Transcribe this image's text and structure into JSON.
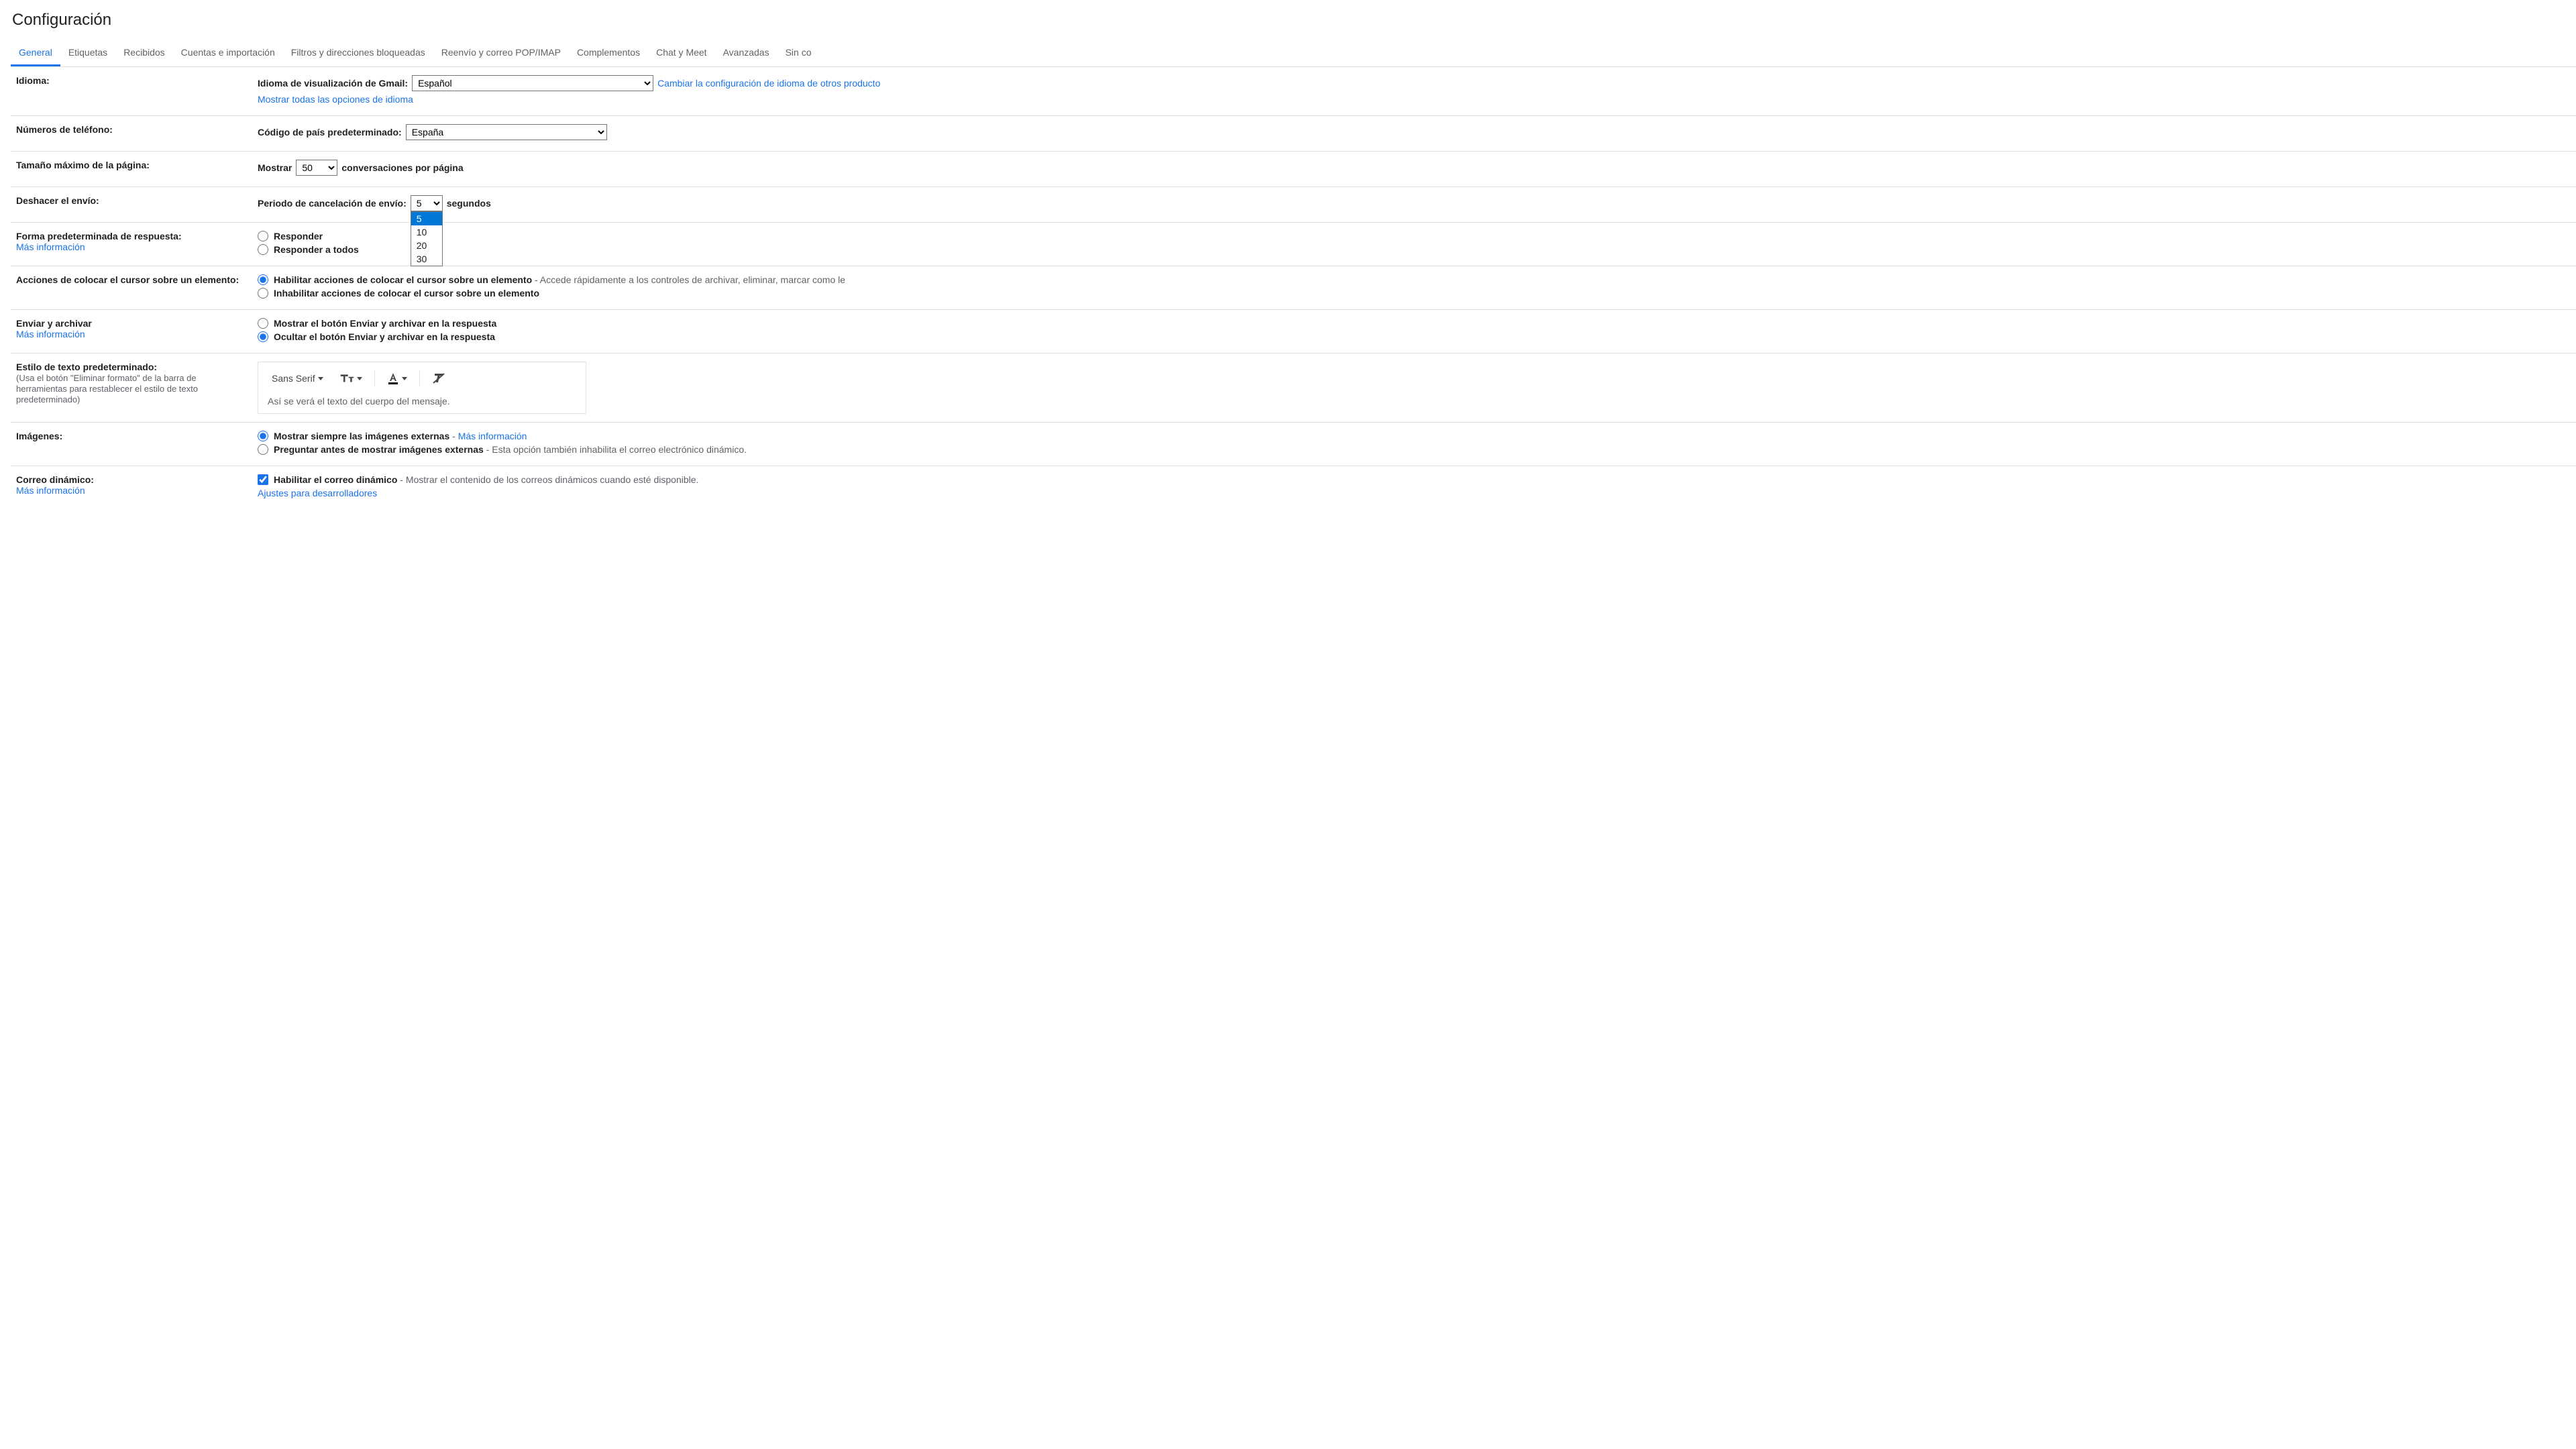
{
  "title": "Configuración",
  "tabs": [
    {
      "label": "General",
      "active": true
    },
    {
      "label": "Etiquetas"
    },
    {
      "label": "Recibidos"
    },
    {
      "label": "Cuentas e importación"
    },
    {
      "label": "Filtros y direcciones bloqueadas"
    },
    {
      "label": "Reenvío y correo POP/IMAP"
    },
    {
      "label": "Complementos"
    },
    {
      "label": "Chat y Meet"
    },
    {
      "label": "Avanzadas"
    },
    {
      "label": "Sin co"
    }
  ],
  "idioma": {
    "section_label": "Idioma:",
    "display_label": "Idioma de visualización de Gmail:",
    "selected": "Español",
    "change_link": "Cambiar la configuración de idioma de otros producto",
    "show_all_link": "Mostrar todas las opciones de idioma"
  },
  "telefono": {
    "section_label": "Números de teléfono:",
    "country_code_label": "Código de país predeterminado:",
    "selected": "España"
  },
  "page_size": {
    "section_label": "Tamaño máximo de la página:",
    "prefix": "Mostrar",
    "selected": "50",
    "suffix": "conversaciones por página"
  },
  "undo_send": {
    "section_label": "Deshacer el envío:",
    "label": "Periodo de cancelación de envío:",
    "selected": "5",
    "suffix": "segundos",
    "options": [
      "5",
      "10",
      "20",
      "30"
    ]
  },
  "reply": {
    "section_label": "Forma predeterminada de respuesta:",
    "more_info": "Más información",
    "option1": "Responder",
    "option2": "Responder a todos"
  },
  "hover": {
    "section_label": "Acciones de colocar el cursor sobre un elemento:",
    "option1": "Habilitar acciones de colocar el cursor sobre un elemento",
    "option1_desc": " - Accede rápidamente a los controles de archivar, eliminar, marcar como le",
    "option2": "Inhabilitar acciones de colocar el cursor sobre un elemento"
  },
  "send_archive": {
    "section_label": "Enviar y archivar",
    "more_info": "Más información",
    "option1": "Mostrar el botón Enviar y archivar en la respuesta",
    "option2": "Ocultar el botón Enviar y archivar en la respuesta"
  },
  "text_style": {
    "section_label": "Estilo de texto predeterminado:",
    "section_sublabel": "(Usa el botón \"Eliminar formato\" de la barra de herramientas para restablecer el estilo de texto predeterminado)",
    "font": "Sans Serif",
    "preview": "Así se verá el texto del cuerpo del mensaje."
  },
  "images": {
    "section_label": "Imágenes:",
    "option1": "Mostrar siempre las imágenes externas",
    "option1_link": "Más información",
    "option2": "Preguntar antes de mostrar imágenes externas",
    "option2_desc": " - Esta opción también inhabilita el correo electrónico dinámico."
  },
  "dynamic": {
    "section_label": "Correo dinámico:",
    "more_info": "Más información",
    "checkbox_label": "Habilitar el correo dinámico",
    "checkbox_desc": " - Mostrar el contenido de los correos dinámicos cuando esté disponible.",
    "dev_link": "Ajustes para desarrolladores"
  }
}
